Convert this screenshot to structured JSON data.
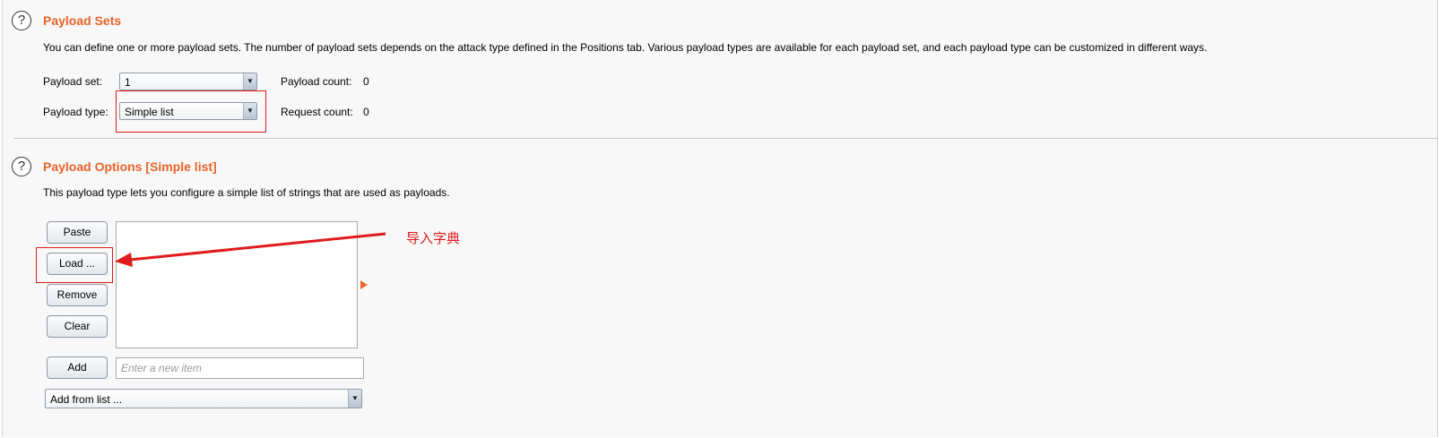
{
  "payload_sets": {
    "title": "Payload Sets",
    "description": "You can define one or more payload sets. The number of payload sets depends on the attack type defined in the Positions tab. Various payload types are available for each payload set, and each payload type can be customized in different ways.",
    "payload_set_label": "Payload set:",
    "payload_set_value": "1",
    "payload_type_label": "Payload type:",
    "payload_type_value": "Simple list",
    "payload_count_label": "Payload count:",
    "payload_count_value": "0",
    "request_count_label": "Request count:",
    "request_count_value": "0"
  },
  "payload_options": {
    "title": "Payload Options [Simple list]",
    "description": "This payload type lets you configure a simple list of strings that are used as payloads.",
    "buttons": {
      "paste": "Paste",
      "load": "Load ...",
      "remove": "Remove",
      "clear": "Clear",
      "add": "Add"
    },
    "new_item_placeholder": "Enter a new item",
    "add_from_list_value": "Add from list ..."
  },
  "annotation": {
    "text": "导入字典",
    "color": "#e01b1b"
  },
  "colors": {
    "section_title": "#e8632a",
    "annotation_red": "#e01b1b"
  },
  "icons": {
    "help": "help-circle-icon",
    "dropdown": "chevron-down-icon",
    "splitter": "triangle-right-icon"
  }
}
